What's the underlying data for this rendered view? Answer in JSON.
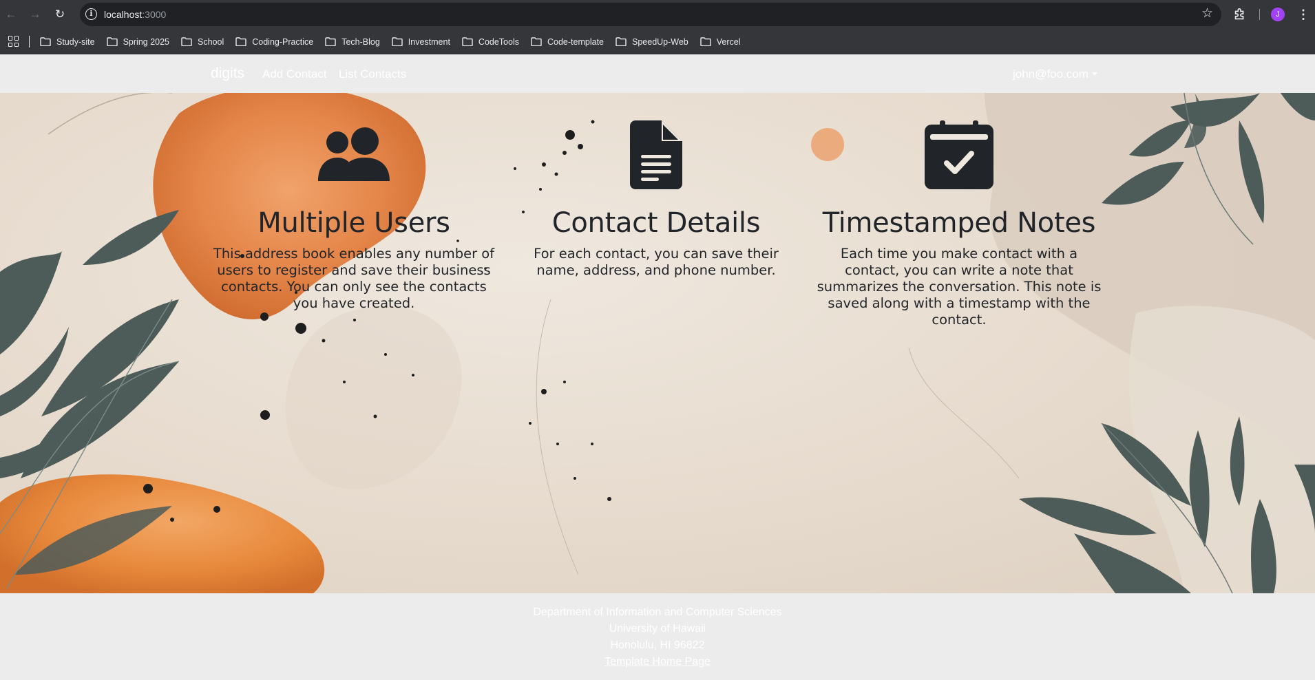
{
  "browser": {
    "url_host": "localhost",
    "url_port": ":3000",
    "profile_initial": "J",
    "bookmarks": [
      {
        "label": "Study-site",
        "icon": "folder-icon"
      },
      {
        "label": "Spring 2025",
        "icon": "folder-icon"
      },
      {
        "label": "School",
        "icon": "folder-icon"
      },
      {
        "label": "Coding-Practice",
        "icon": "folder-icon"
      },
      {
        "label": "Tech-Blog",
        "icon": "folder-icon"
      },
      {
        "label": "Investment",
        "icon": "folder-icon"
      },
      {
        "label": "CodeTools",
        "icon": "folder-icon"
      },
      {
        "label": "Code-template",
        "icon": "folder-icon"
      },
      {
        "label": "SpeedUp-Web",
        "icon": "folder-icon"
      },
      {
        "label": "Vercel",
        "icon": "folder-icon"
      }
    ]
  },
  "navbar": {
    "brand": "digits",
    "links": [
      {
        "label": "Add Contact"
      },
      {
        "label": "List Contacts"
      }
    ],
    "user": "john@foo.com"
  },
  "features": [
    {
      "icon": "users-icon",
      "title": "Multiple Users",
      "text": "This address book enables any number of users to register and save their business contacts. You can only see the contacts you have created."
    },
    {
      "icon": "file-text-icon",
      "title": "Contact Details",
      "text": "For each contact, you can save their name, address, and phone number."
    },
    {
      "icon": "calendar-check-icon",
      "title": "Timestamped Notes",
      "text": "Each time you make contact with a contact, you can write a note that summarizes the conversation. This note is saved along with a timestamp with the contact."
    }
  ],
  "footer": {
    "line1": "Department of Information and Computer Sciences",
    "line2": "University of Hawaii",
    "line3": "Honolulu, HI 96822",
    "link": "Template Home Page"
  },
  "colors": {
    "chrome_dark": "#35363a",
    "omnibox": "#202124",
    "navbar_bg": "#ececec",
    "text_dark": "#212529",
    "accent_orange": "#e07a35",
    "leaf_green": "#4b5a57"
  }
}
